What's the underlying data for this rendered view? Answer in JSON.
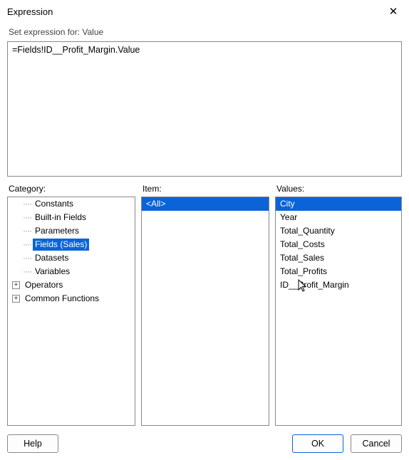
{
  "window": {
    "title": "Expression",
    "close_glyph": "✕"
  },
  "header": {
    "subtitle": "Set expression for: Value"
  },
  "expression": {
    "value": "=Fields!ID__Profit_Margin.Value"
  },
  "columns": {
    "category_label": "Category:",
    "item_label": "Item:",
    "values_label": "Values:"
  },
  "category_tree": [
    {
      "label": "Constants",
      "depth": 1,
      "expandable": false,
      "selected": false
    },
    {
      "label": "Built-in Fields",
      "depth": 1,
      "expandable": false,
      "selected": false
    },
    {
      "label": "Parameters",
      "depth": 1,
      "expandable": false,
      "selected": false
    },
    {
      "label": "Fields (Sales)",
      "depth": 1,
      "expandable": false,
      "selected": true
    },
    {
      "label": "Datasets",
      "depth": 1,
      "expandable": false,
      "selected": false
    },
    {
      "label": "Variables",
      "depth": 1,
      "expandable": false,
      "selected": false
    },
    {
      "label": "Operators",
      "depth": 0,
      "expandable": true,
      "expand_glyph": "+",
      "selected": false
    },
    {
      "label": "Common Functions",
      "depth": 0,
      "expandable": true,
      "expand_glyph": "+",
      "selected": false
    }
  ],
  "item_list": [
    {
      "label": "<All>",
      "selected": true
    }
  ],
  "values_list": [
    {
      "label": "City",
      "selected": true
    },
    {
      "label": "Year",
      "selected": false
    },
    {
      "label": "Total_Quantity",
      "selected": false
    },
    {
      "label": "Total_Costs",
      "selected": false
    },
    {
      "label": "Total_Sales",
      "selected": false
    },
    {
      "label": "Total_Profits",
      "selected": false
    },
    {
      "label": "ID__Profit_Margin",
      "selected": false
    }
  ],
  "footer": {
    "help_label": "Help",
    "ok_label": "OK",
    "cancel_label": "Cancel"
  }
}
